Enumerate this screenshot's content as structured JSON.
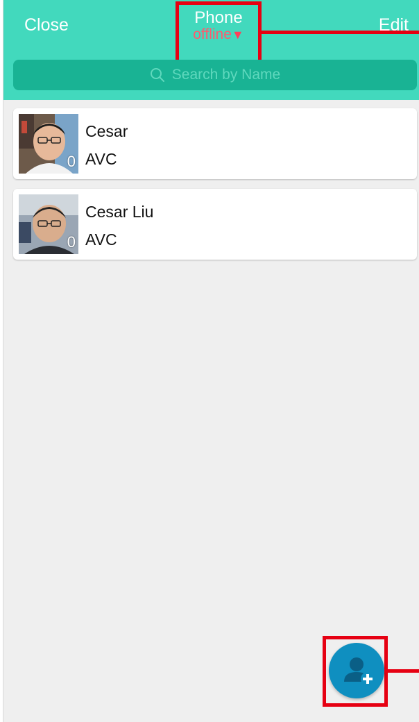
{
  "header": {
    "close_label": "Close",
    "title": "Phone",
    "status": "offline",
    "status_arrow": "▼",
    "edit_label": "Edit"
  },
  "search": {
    "placeholder": "Search by Name"
  },
  "contacts": [
    {
      "name": "Cesar",
      "subtitle": "AVC",
      "avatar_count": "0"
    },
    {
      "name": "Cesar Liu",
      "subtitle": "AVC",
      "avatar_count": "0"
    }
  ],
  "fab": {
    "icon": "add-contact-icon"
  },
  "colors": {
    "header_bg": "#42d9bd",
    "search_bg": "#19b394",
    "status": "#ff5a6e",
    "fab": "#0f8fc0",
    "highlight": "#e60012",
    "background": "#efefef"
  }
}
